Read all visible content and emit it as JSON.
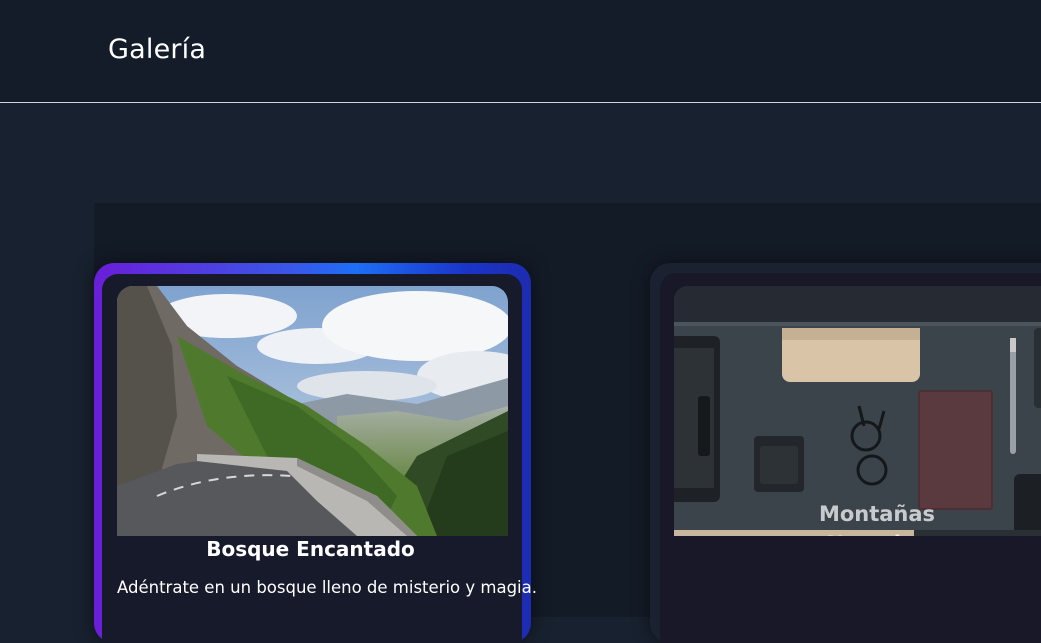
{
  "header": {
    "title": "Galería"
  },
  "gallery": {
    "cards": [
      {
        "title": "Bosque Encantado",
        "description": "Adéntrate en un bosque lleno de misterio y magia.",
        "image_icon": "mountain-road-photo"
      },
      {
        "title": "Montañas Nevadas",
        "image_icon": "desk-flatlay-photo"
      }
    ]
  },
  "colors": {
    "header_bg": "#141c29",
    "page_bg": "#18212f",
    "card_gradient_start": "#6a1ed8",
    "card_gradient_end": "#1d2bb0"
  }
}
